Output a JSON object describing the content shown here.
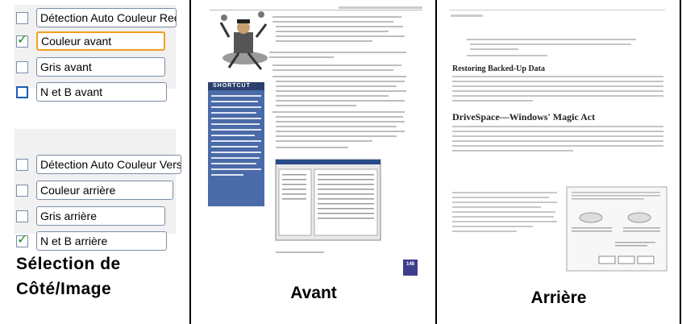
{
  "options": {
    "front": [
      {
        "label": "Détection Auto Couleur Recto",
        "checked": false,
        "selected": false
      },
      {
        "label": "Couleur avant",
        "checked": true,
        "selected": true
      },
      {
        "label": "Gris avant",
        "checked": false,
        "selected": false
      },
      {
        "label": "N et B avant",
        "checked": false,
        "selected": false
      }
    ],
    "back": [
      {
        "label": "Détection Auto Couleur Verso",
        "checked": false,
        "selected": false
      },
      {
        "label": "Couleur arrière",
        "checked": false,
        "selected": false
      },
      {
        "label": "Gris arrière",
        "checked": false,
        "selected": false
      },
      {
        "label": "N et B arrière",
        "checked": true,
        "selected": false
      }
    ]
  },
  "captions": {
    "left_line1": "Sélection de",
    "left_line2": "Côté/Image",
    "front": "Avant",
    "back": "Arrière"
  },
  "front_page": {
    "shortcut_title": "SHORTCUT",
    "page_number": "148"
  },
  "back_page": {
    "heading1": "Restoring Backed-Up Data",
    "heading2": "DriveSpace—Windows' Magic Act"
  },
  "colors": {
    "selected_border": "#f0a020",
    "checkbox_tick": "#1a8a1a",
    "shortcut_blue": "#4a6aa8"
  }
}
